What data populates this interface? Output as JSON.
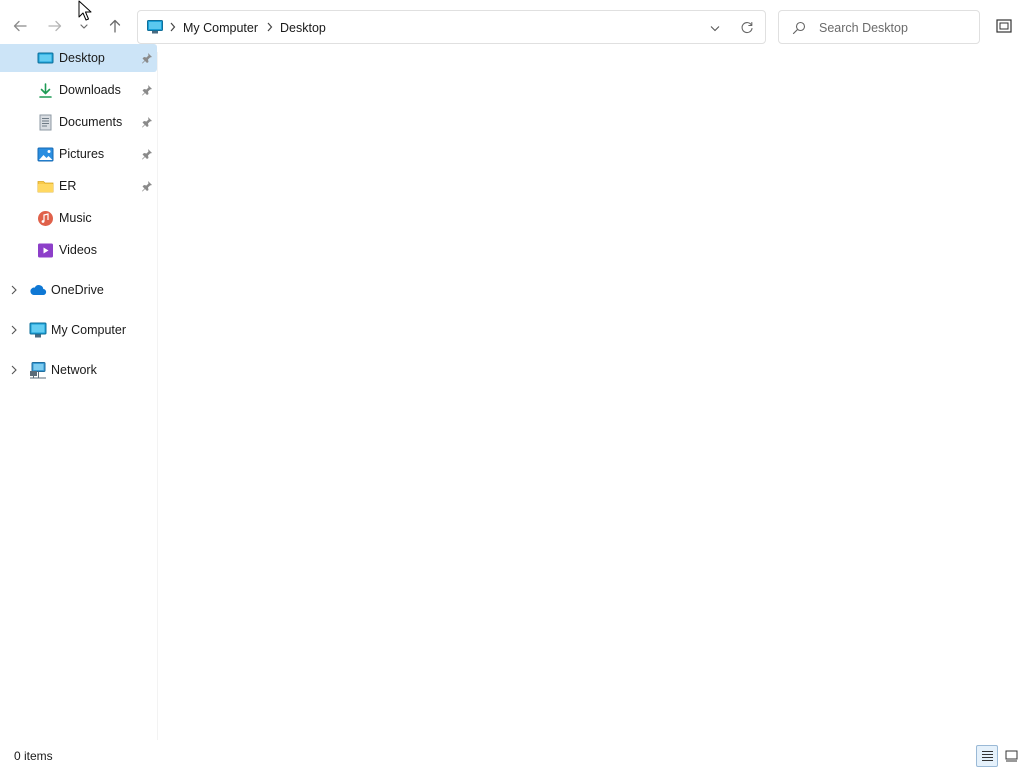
{
  "toolbar": {
    "back_icon": "arrow-left-icon",
    "forward_icon": "arrow-right-icon",
    "recent_icon": "chevron-down-icon",
    "up_icon": "arrow-up-icon"
  },
  "address_bar": {
    "location_icon": "computer-icon",
    "breadcrumbs": [
      {
        "label": "My Computer"
      },
      {
        "label": "Desktop"
      }
    ],
    "dropdown_icon": "chevron-down-icon",
    "refresh_icon": "refresh-icon"
  },
  "search": {
    "placeholder": "Search Desktop",
    "value": ""
  },
  "sidebar": {
    "quick_access": [
      {
        "label": "Desktop",
        "icon": "desktop-icon",
        "pinned": true,
        "selected": true
      },
      {
        "label": "Downloads",
        "icon": "download-icon",
        "pinned": true
      },
      {
        "label": "Documents",
        "icon": "document-icon",
        "pinned": true
      },
      {
        "label": "Pictures",
        "icon": "pictures-icon",
        "pinned": true
      },
      {
        "label": "ER",
        "icon": "folder-icon",
        "pinned": true
      },
      {
        "label": "Music",
        "icon": "music-icon",
        "pinned": false
      },
      {
        "label": "Videos",
        "icon": "video-icon",
        "pinned": false
      }
    ],
    "roots": [
      {
        "label": "OneDrive",
        "icon": "cloud-icon"
      },
      {
        "label": "My Computer",
        "icon": "computer-icon"
      },
      {
        "label": "Network",
        "icon": "network-icon"
      }
    ]
  },
  "status": {
    "item_count": "0 items"
  },
  "colors": {
    "selection": "#cce4f7",
    "accent": "#0067c0"
  }
}
